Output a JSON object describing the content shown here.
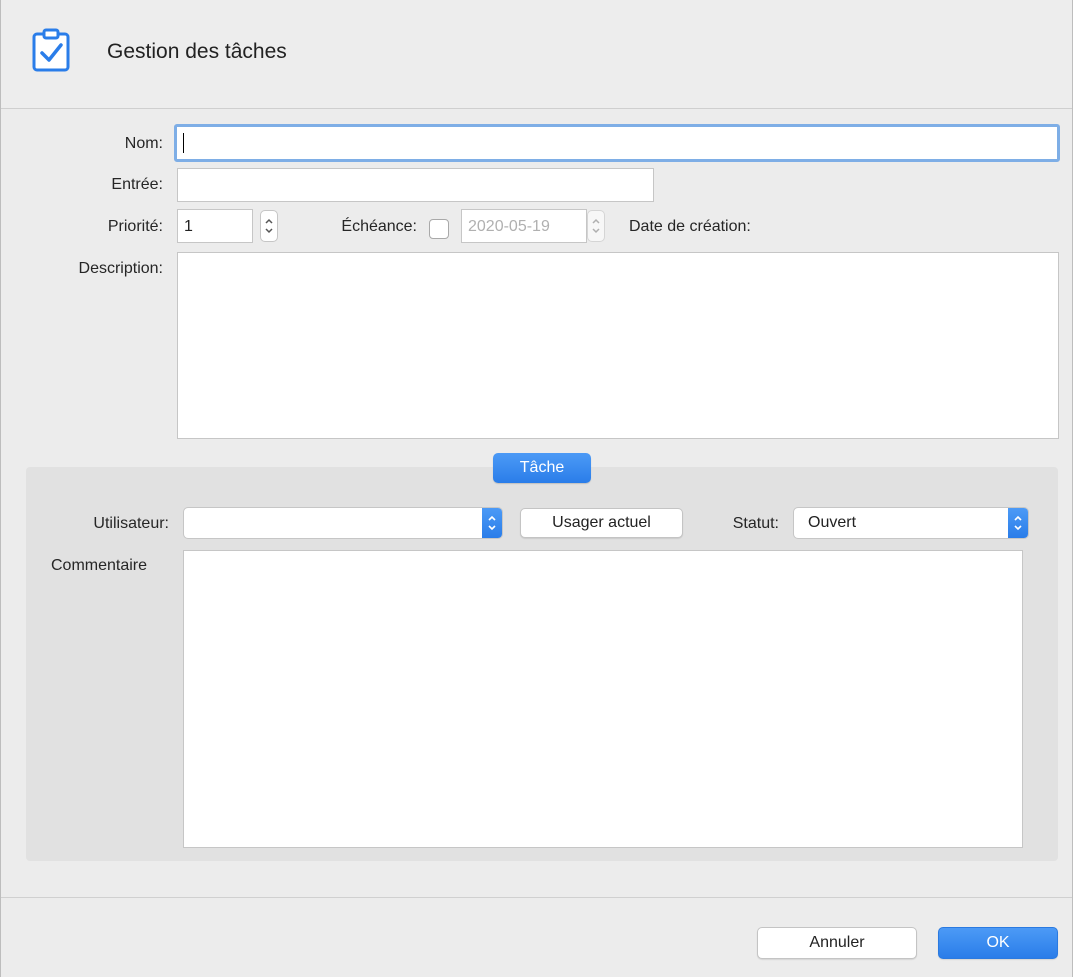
{
  "window": {
    "title": "Gestion des tâches"
  },
  "form": {
    "nom_label": "Nom:",
    "nom_value": "",
    "entree_label": "Entrée:",
    "entree_value": "",
    "priorite_label": "Priorité:",
    "priorite_value": "1",
    "echeance_label": "Échéance:",
    "echeance_checked": false,
    "echeance_value": "2020-05-19",
    "date_creation_label": "Date de création:",
    "description_label": "Description:",
    "description_value": ""
  },
  "task_panel": {
    "tab_label": "Tâche",
    "utilisateur_label": "Utilisateur:",
    "utilisateur_value": "",
    "usager_actuel_button": "Usager actuel",
    "statut_label": "Statut:",
    "statut_value": "Ouvert",
    "commentaire_label": "Commentaire",
    "commentaire_value": ""
  },
  "footer": {
    "cancel_label": "Annuler",
    "ok_label": "OK"
  },
  "colors": {
    "accent": "#2a7de9",
    "focus_ring": "#7eaee6",
    "window_bg": "#ececec",
    "panel_bg": "#e1e1e1"
  },
  "icons": {
    "header": "clipboard-check-icon",
    "stepper": "up-down-stepper-icon",
    "select": "chevron-up-down-icon"
  }
}
